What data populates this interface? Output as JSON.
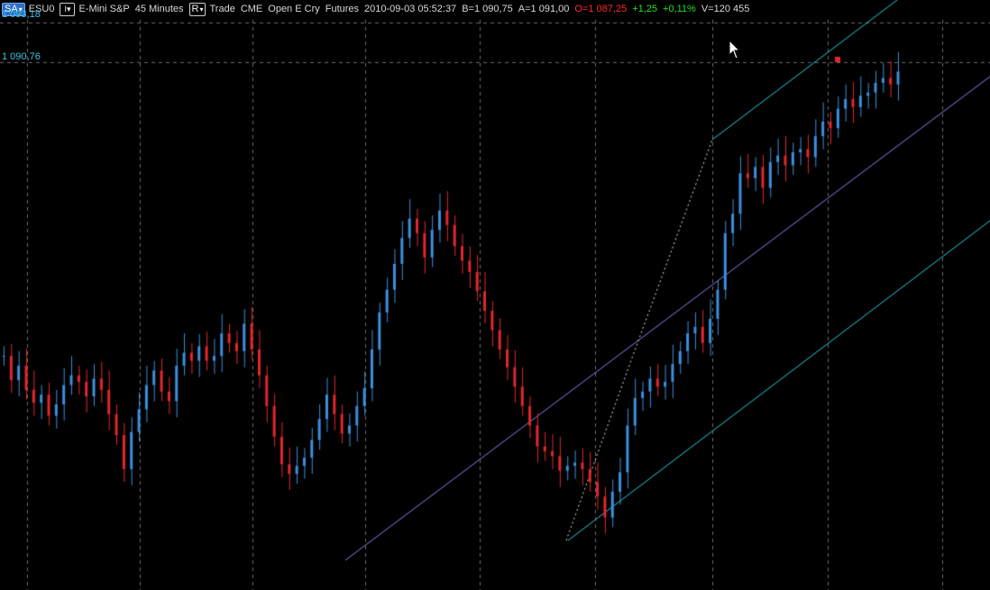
{
  "toolbar": {
    "exchange_btn": "SA",
    "symbol": "ESU0",
    "instrument": "E-Mini S&P",
    "interval": "45 Minutes",
    "mode_btn": "R",
    "trade": "Trade",
    "exchange": "CME",
    "open_label": "Open E Cry",
    "type": "Futures",
    "datetime": "2010-09-03  05:52:37",
    "bid": "B=1 090,75",
    "ask": "A=1 091,00",
    "open": "O=1 087,25",
    "change": "+1,25",
    "change_pct": "+0,11%",
    "volume": "V=120 455"
  },
  "price_labels": {
    "top": "1 093,18",
    "current": "1 090,76"
  },
  "colors": {
    "up": "#3b8fdc",
    "down": "#e2262c",
    "grid": "#6a6a6a",
    "channel_outer": "#29cfdc",
    "channel_mid": "#8a82f2",
    "text_accent": "#3cc4e4"
  },
  "chart_data": {
    "type": "candlestick",
    "series": [
      {
        "name": "ESU0",
        "values": [
          1073.2,
          1071.7,
          1072.6,
          1071.1,
          1070.3,
          1070.8,
          1069.5,
          1070.2,
          1071.4,
          1072.0,
          1071.6,
          1070.7,
          1071.8,
          1071.1,
          1069.6,
          1068.3,
          1066.2,
          1068.5,
          1069.9,
          1071.4,
          1072.3,
          1071.0,
          1070.4,
          1072.6,
          1073.4,
          1072.9,
          1073.8,
          1072.9,
          1073.2,
          1074.6,
          1074.0,
          1073.5,
          1075.2,
          1073.6,
          1072.0,
          1070.1,
          1068.2,
          1066.5,
          1065.9,
          1066.4,
          1066.9,
          1068.0,
          1069.3,
          1070.8,
          1069.6,
          1068.4,
          1068.9,
          1070.1,
          1071.2,
          1073.6,
          1075.9,
          1077.3,
          1078.9,
          1080.5,
          1081.7,
          1080.8,
          1079.3,
          1081.0,
          1082.2,
          1081.3,
          1080.0,
          1079.1,
          1078.4,
          1077.2,
          1076.0,
          1074.8,
          1073.6,
          1072.5,
          1071.3,
          1070.1,
          1068.9,
          1067.6,
          1067.3,
          1067.0,
          1066.1,
          1066.4,
          1066.6,
          1066.2,
          1065.4,
          1064.5,
          1063.2,
          1064.8,
          1066.0,
          1068.9,
          1070.6,
          1071.0,
          1071.8,
          1071.3,
          1071.6,
          1072.7,
          1073.5,
          1074.6,
          1075.0,
          1074.0,
          1075.5,
          1077.3,
          1080.8,
          1082.0,
          1084.5,
          1084.2,
          1084.9,
          1083.6,
          1085.2,
          1085.6,
          1085.0,
          1085.8,
          1086.0,
          1085.5,
          1086.8,
          1087.7,
          1087.3,
          1088.5,
          1089.1,
          1088.6,
          1089.3,
          1089.5,
          1090.1,
          1090.4,
          1090.0,
          1090.8
        ]
      }
    ],
    "grid": true
  }
}
